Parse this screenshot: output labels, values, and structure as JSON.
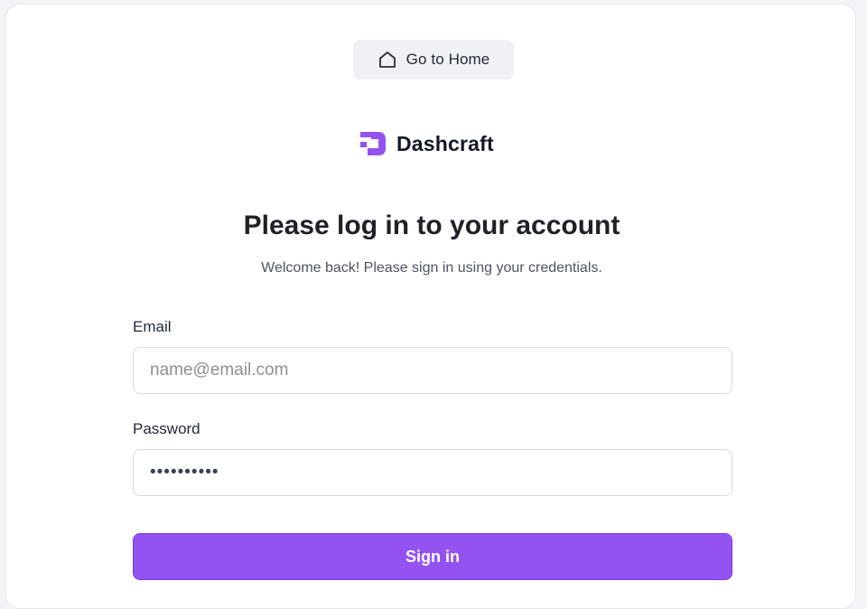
{
  "home_button": {
    "label": "Go to Home",
    "icon": "home-icon"
  },
  "brand": {
    "name": "Dashcraft",
    "logo_color": "#9452f0"
  },
  "login": {
    "title": "Please log in to your account",
    "subtitle": "Welcome back! Please sign in using your credentials.",
    "email_label": "Email",
    "email_placeholder": "name@email.com",
    "password_label": "Password",
    "password_value": "••••••••••",
    "submit_label": "Sign in"
  },
  "colors": {
    "accent": "#9452f0",
    "text": "#1f2128"
  }
}
